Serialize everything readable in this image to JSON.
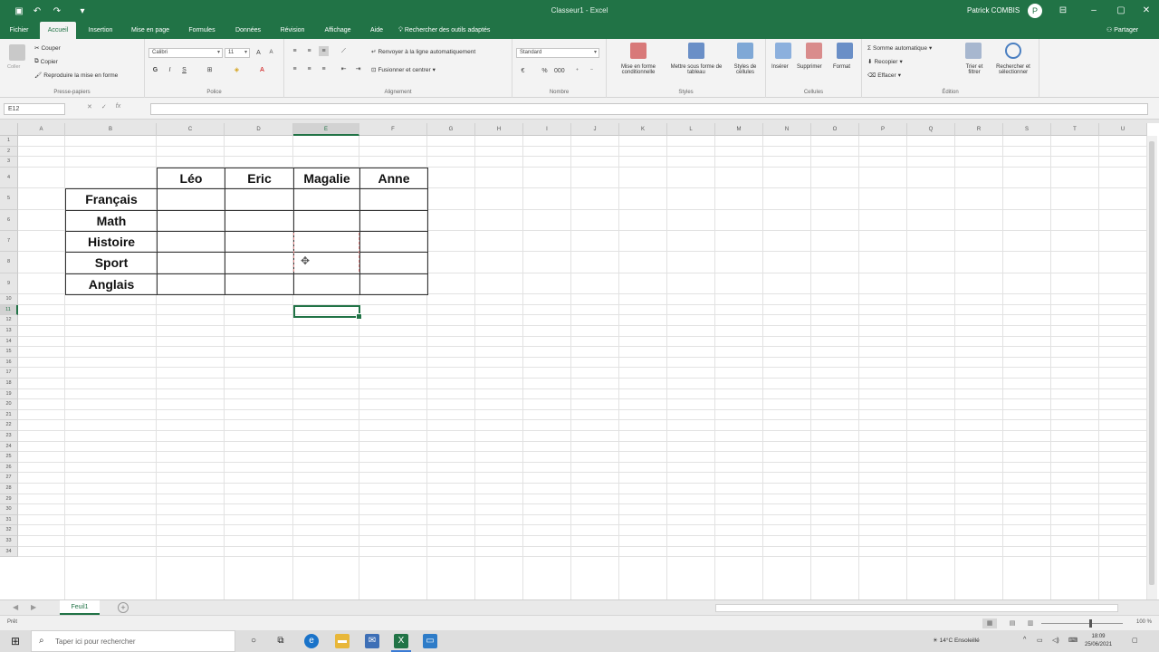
{
  "window": {
    "title": "Classeur1 - Excel",
    "user": "Patrick COMBIS",
    "avatar_initial": "P"
  },
  "quick_access": {
    "save_icon": "save-icon",
    "undo_icon": "undo-icon",
    "redo_icon": "redo-icon"
  },
  "ribbon_tabs": [
    "Fichier",
    "Accueil",
    "Insertion",
    "Mise en page",
    "Formules",
    "Données",
    "Révision",
    "Affichage",
    "Aide"
  ],
  "active_tab": "Accueil",
  "tell_me": "Rechercher des outils adaptés",
  "share_label": "Partager",
  "ribbon": {
    "clipboard": {
      "paste": "Coller",
      "cut": "Couper",
      "copy": "Copier",
      "format_painter": "Reproduire la mise en forme",
      "label": "Presse-papiers"
    },
    "font": {
      "name": "Calibri",
      "size": "11",
      "bold": "G",
      "italic": "I",
      "underline": "S",
      "label": "Police"
    },
    "alignment": {
      "wrap": "Renvoyer à la ligne automatiquement",
      "merge": "Fusionner et centrer",
      "label": "Alignement"
    },
    "number": {
      "format": "Standard",
      "label": "Nombre"
    },
    "styles": {
      "conditional": "Mise en forme conditionnelle",
      "table": "Mettre sous forme de tableau",
      "cell_styles": "Styles de cellules",
      "label": "Styles"
    },
    "cells": {
      "insert": "Insérer",
      "delete": "Supprimer",
      "format": "Format",
      "label": "Cellules"
    },
    "editing": {
      "autosum": "Somme automatique",
      "fill": "Recopier",
      "clear": "Effacer",
      "sort": "Trier et filtrer",
      "find": "Rechercher et sélectionner",
      "label": "Édition"
    }
  },
  "formula_bar": {
    "name_box": "E12",
    "cancel": "✕",
    "enter": "✓",
    "fx": "fx",
    "value": ""
  },
  "columns": [
    "A",
    "B",
    "C",
    "D",
    "E",
    "F",
    "G",
    "H",
    "I",
    "J",
    "K",
    "L",
    "M",
    "N",
    "O",
    "P",
    "Q",
    "R",
    "S",
    "T",
    "U"
  ],
  "selected_column": "E",
  "selected_row": 11,
  "row_count": 34,
  "table": {
    "headers": [
      "Léo",
      "Eric",
      "Magalie",
      "Anne"
    ],
    "subjects": [
      "Français",
      "Math",
      "Histoire",
      "Sport",
      "Anglais"
    ]
  },
  "sheet": {
    "tab": "Feuil1",
    "add": "+"
  },
  "status": {
    "ready": "Prêt",
    "zoom": "100 %"
  },
  "taskbar": {
    "search_placeholder": "Taper ici pour rechercher",
    "weather": "14°C Ensoleillé",
    "time": "18:09",
    "date": "25/06/2021"
  },
  "colors": {
    "excel_green": "#217346",
    "table_border": "#333333"
  }
}
